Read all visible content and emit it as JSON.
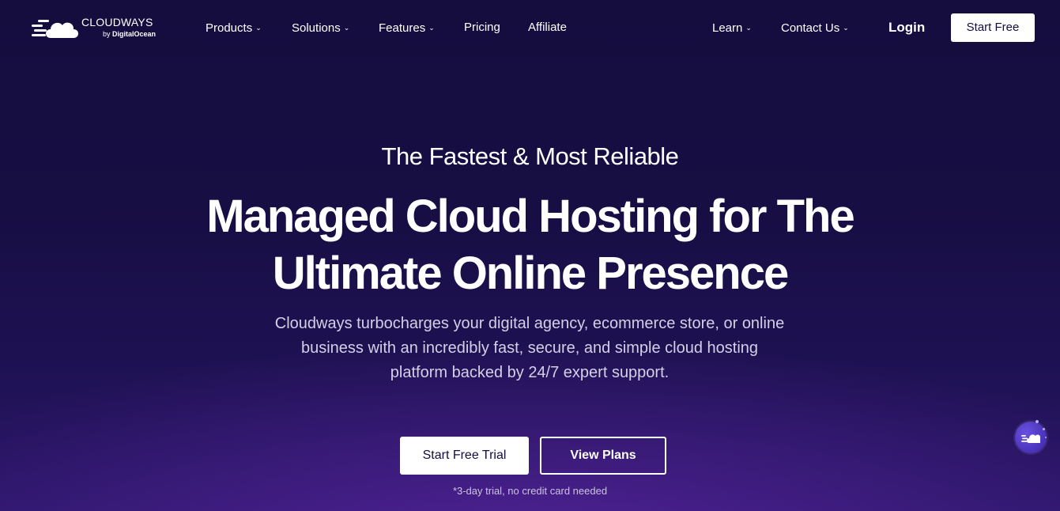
{
  "brand": {
    "name": "CLOUDWAYS",
    "by_prefix": "by ",
    "by_company": "DigitalOcean",
    "logo_icon": "cloud-speed-icon"
  },
  "nav": {
    "items": [
      {
        "label": "Products",
        "dropdown": true
      },
      {
        "label": "Solutions",
        "dropdown": true
      },
      {
        "label": "Features",
        "dropdown": true
      },
      {
        "label": "Pricing",
        "dropdown": false
      },
      {
        "label": "Affiliate",
        "dropdown": false
      }
    ],
    "right_items": [
      {
        "label": "Learn",
        "dropdown": true
      },
      {
        "label": "Contact Us",
        "dropdown": true
      }
    ],
    "chevron": "⌄",
    "login_label": "Login",
    "start_free_label": "Start Free"
  },
  "hero": {
    "eyebrow": "The Fastest & Most Reliable",
    "headline_line1": "Managed Cloud Hosting for The",
    "headline_line2": "Ultimate Online Presence",
    "sub_line1": "Cloudways turbocharges your digital agency, ecommerce store, or online",
    "sub_line2": "business with an incredibly fast, secure, and simple cloud hosting",
    "sub_line3": "platform backed by 24/7 expert support.",
    "primary_cta": "Start Free Trial",
    "secondary_cta": "View Plans",
    "note": "*3-day trial, no credit card needed"
  },
  "chat_widget": {
    "icon": "chat-cloud-icon"
  },
  "colors": {
    "background": "#150d3d",
    "accent_purple": "#5b3fd6",
    "text": "#ffffff"
  }
}
